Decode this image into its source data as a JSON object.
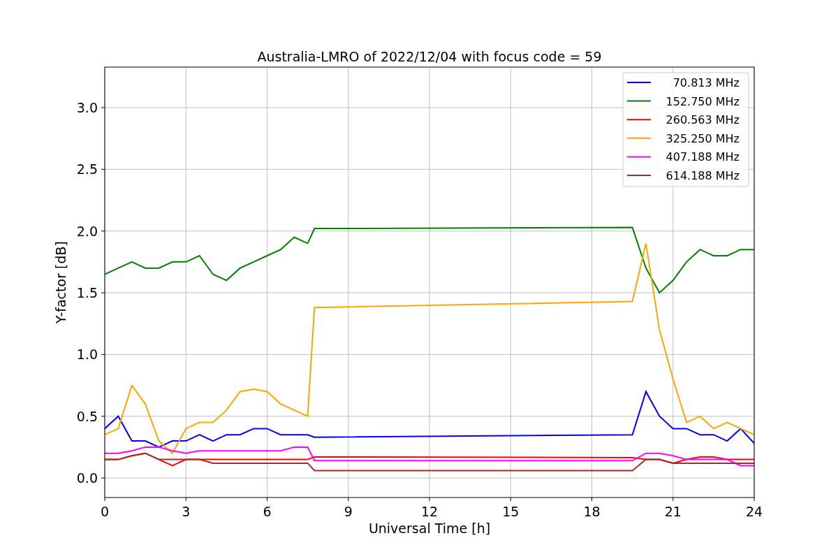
{
  "chart_data": {
    "type": "line",
    "title": "Australia-LMRO of 2022/12/04 with focus code = 59",
    "xlabel": "Universal Time [h]",
    "ylabel": "Y-factor [dB]",
    "x": [
      0,
      0.5,
      1,
      1.5,
      2,
      2.5,
      3,
      3.5,
      4,
      4.5,
      5,
      5.5,
      6,
      6.5,
      7,
      7.5,
      7.75,
      19.5,
      20,
      20.5,
      21,
      21.5,
      22,
      22.5,
      23,
      23.5,
      24
    ],
    "series": [
      {
        "name": "70.813 MHz",
        "color": "#0000ff",
        "values": [
          0.4,
          0.5,
          0.3,
          0.3,
          0.25,
          0.3,
          0.3,
          0.35,
          0.3,
          0.35,
          0.35,
          0.4,
          0.4,
          0.35,
          0.35,
          0.35,
          0.33,
          0.35,
          0.7,
          0.5,
          0.4,
          0.4,
          0.35,
          0.35,
          0.3,
          0.4,
          0.28
        ]
      },
      {
        "name": "152.750 MHz",
        "color": "#008000",
        "values": [
          1.65,
          1.7,
          1.75,
          1.7,
          1.7,
          1.75,
          1.75,
          1.8,
          1.65,
          1.6,
          1.7,
          1.75,
          1.8,
          1.85,
          1.95,
          1.9,
          2.02,
          2.03,
          1.7,
          1.5,
          1.6,
          1.75,
          1.85,
          1.8,
          1.8,
          1.85,
          1.85
        ]
      },
      {
        "name": "260.563 MHz",
        "color": "#ff0000",
        "values": [
          0.15,
          0.15,
          0.18,
          0.2,
          0.15,
          0.1,
          0.15,
          0.15,
          0.15,
          0.15,
          0.15,
          0.15,
          0.15,
          0.15,
          0.15,
          0.15,
          0.17,
          0.165,
          0.15,
          0.15,
          0.12,
          0.15,
          0.17,
          0.17,
          0.15,
          0.15,
          0.15
        ]
      },
      {
        "name": "325.250 MHz",
        "color": "#ffa500",
        "values": [
          0.35,
          0.4,
          0.75,
          0.6,
          0.3,
          0.2,
          0.4,
          0.45,
          0.45,
          0.55,
          0.7,
          0.72,
          0.7,
          0.6,
          0.55,
          0.5,
          1.38,
          1.43,
          1.9,
          1.2,
          0.8,
          0.45,
          0.5,
          0.4,
          0.45,
          0.4,
          0.35
        ]
      },
      {
        "name": "407.188 MHz",
        "color": "#ff00ff",
        "values": [
          0.2,
          0.2,
          0.22,
          0.25,
          0.25,
          0.22,
          0.2,
          0.22,
          0.22,
          0.22,
          0.22,
          0.22,
          0.22,
          0.22,
          0.25,
          0.25,
          0.14,
          0.14,
          0.2,
          0.2,
          0.18,
          0.15,
          0.15,
          0.15,
          0.15,
          0.1,
          0.1
        ]
      },
      {
        "name": "614.188 MHz",
        "color": "#a52a2a",
        "values": [
          0.15,
          0.15,
          0.18,
          0.2,
          0.15,
          0.15,
          0.15,
          0.15,
          0.12,
          0.12,
          0.12,
          0.12,
          0.12,
          0.12,
          0.12,
          0.12,
          0.06,
          0.06,
          0.15,
          0.15,
          0.12,
          0.12,
          0.12,
          0.12,
          0.12,
          0.12,
          0.12
        ]
      }
    ],
    "grid": true,
    "legend": true,
    "xlim": [
      0,
      24
    ],
    "ylim": [
      -0.158,
      3.328
    ],
    "xticks": [
      0,
      3,
      6,
      9,
      12,
      15,
      18,
      21,
      24
    ],
    "yticks": [
      {
        "value": 0,
        "label": "0.0"
      },
      {
        "value": 0.5,
        "label": "0.5"
      },
      {
        "value": 1,
        "label": "1.0"
      },
      {
        "value": 1.5,
        "label": "1.5"
      },
      {
        "value": 2,
        "label": "2.0"
      },
      {
        "value": 2.5,
        "label": "2.5"
      },
      {
        "value": 3,
        "label": "3.0"
      }
    ]
  }
}
